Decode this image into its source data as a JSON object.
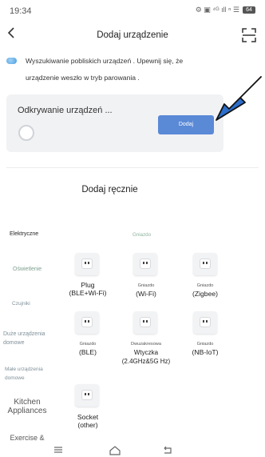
{
  "status_bar": {
    "time": "19:34",
    "icons_text": "⚙ ▣ ⁴ᴳ ıll ⁿ ☰",
    "battery": "64"
  },
  "header": {
    "title": "Dodaj urządzenie",
    "back_icon": "back-arrow-icon",
    "scan_icon": "scan-icon"
  },
  "info": {
    "line1": "Wyszukiwanie pobliskich urządzeń . Upewnij się, że",
    "line2": "urządzenie weszło w tryb parowania ."
  },
  "discover": {
    "title": "Odkrywanie urządzeń ...",
    "add_button": "Dodaj"
  },
  "manual": {
    "title": "Dodaj ręcznie"
  },
  "categories": [
    {
      "label": "Elektryczne"
    },
    {
      "label": "Oświetlenie"
    },
    {
      "label": "Czujniki"
    },
    {
      "label": "Duże urządzenia domowe"
    },
    {
      "label": "Małe urządzenia domowe"
    },
    {
      "label": "Kitchen Appliances"
    },
    {
      "label": "Exercise &"
    }
  ],
  "section": {
    "label": "Gniazdo"
  },
  "devices": [
    {
      "title": "Plug",
      "subtitle": "(BLE+Wi-Fi)",
      "sub_small": ""
    },
    {
      "title": "(Wi-Fi)",
      "subtitle": "",
      "sub_small": "Gniazdo"
    },
    {
      "title": "(Zigbee)",
      "subtitle": "",
      "sub_small": "Gniazdo"
    },
    {
      "title": "(BLE)",
      "subtitle": "",
      "sub_small": "Gniazdo"
    },
    {
      "title": "Wtyczka (2.4GHz&5G Hz)",
      "subtitle": "",
      "sub_small": "Dwuzakresowa"
    },
    {
      "title": "(NB-IoT)",
      "subtitle": "",
      "sub_small": "Gniazdo"
    },
    {
      "title": "Socket",
      "subtitle": "(other)",
      "sub_small": ""
    }
  ],
  "bottom_nav": {
    "menu_icon": "menu-icon",
    "home_icon": "home-icon",
    "back_icon": "back-icon"
  },
  "colors": {
    "accent": "#5a89d6",
    "arrow": "#2c6ecb",
    "card_bg": "#f1f2f4"
  }
}
